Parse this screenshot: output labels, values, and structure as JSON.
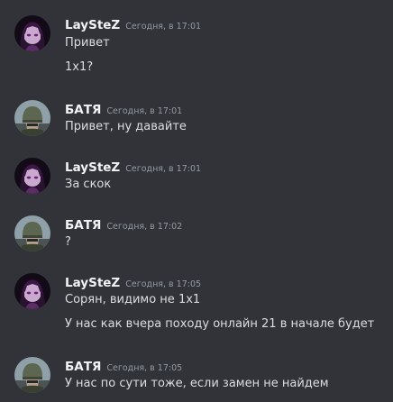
{
  "messages": [
    {
      "author": "LaySteZ",
      "avatar": "dark-purple-haired-character-avatar",
      "timestamp": "Сегодня, в 17:01",
      "lines": [
        "Привет",
        "1x1?"
      ]
    },
    {
      "author": "БАТЯ",
      "avatar": "soldier-helmet-avatar",
      "timestamp": "Сегодня, в 17:01",
      "lines": [
        "Привет, ну давайте"
      ]
    },
    {
      "author": "LaySteZ",
      "avatar": "dark-purple-haired-character-avatar",
      "timestamp": "Сегодня, в 17:01",
      "lines": [
        "За скок"
      ]
    },
    {
      "author": "БАТЯ",
      "avatar": "soldier-helmet-avatar",
      "timestamp": "Сегодня, в 17:02",
      "lines": [
        "?"
      ]
    },
    {
      "author": "LaySteZ",
      "avatar": "dark-purple-haired-character-avatar",
      "timestamp": "Сегодня, в 17:05",
      "lines": [
        "Сорян, видимо не 1x1",
        "У нас как вчера походу онлайн 21 в начале будет"
      ]
    },
    {
      "author": "БАТЯ",
      "avatar": "soldier-helmet-avatar",
      "timestamp": "Сегодня, в 17:05",
      "lines": [
        "У нас по сути тоже, если замен не найдем"
      ]
    }
  ]
}
